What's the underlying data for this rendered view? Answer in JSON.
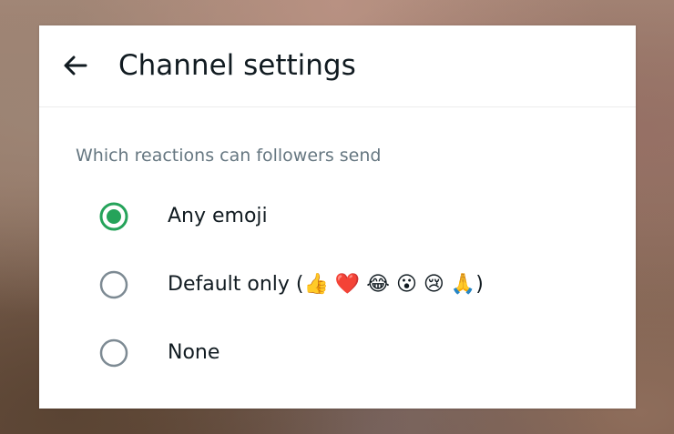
{
  "header": {
    "back_icon": "arrow-left-icon",
    "title": "Channel settings"
  },
  "section": {
    "label": "Which reactions can followers send"
  },
  "options": [
    {
      "label": "Any emoji",
      "selected": true
    },
    {
      "label": "Default only (👍 ❤️ 😂 😮 😢 🙏)",
      "selected": false
    },
    {
      "label": "None",
      "selected": false
    }
  ],
  "colors": {
    "accent": "#25a35a",
    "radio_unselected": "#7d8a93",
    "title_text": "#111b21",
    "section_text": "#667781"
  }
}
